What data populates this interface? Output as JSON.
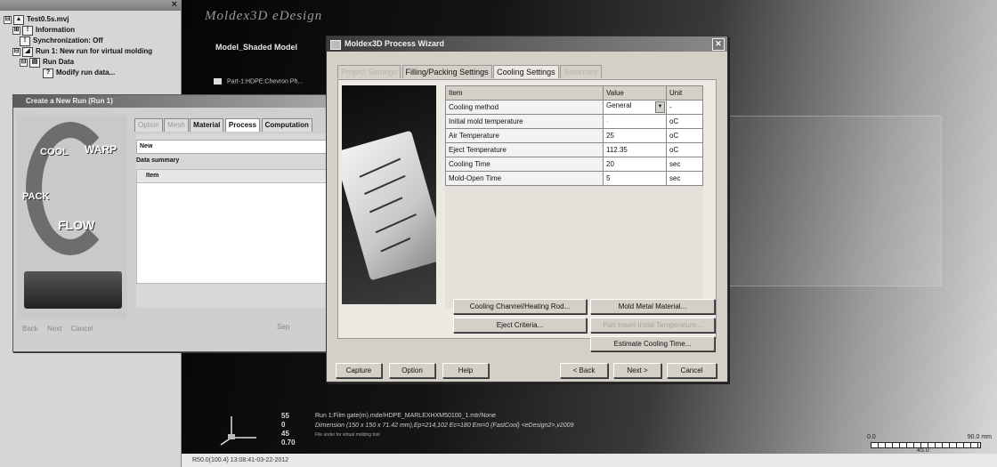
{
  "tree": {
    "items": [
      {
        "pm": "⊟",
        "label": "Test0.5s.mvj",
        "level": 0
      },
      {
        "pm": "⊞",
        "label": "Information",
        "level": 1
      },
      {
        "pm": "",
        "label": "Synchronization: Off",
        "level": 1
      },
      {
        "pm": "⊟",
        "label": "Run 1: New run for virtual molding",
        "level": 1
      },
      {
        "pm": "⊟",
        "label": "Run Data",
        "level": 2
      },
      {
        "pm": "",
        "label": "Modify run data...",
        "level": 3
      }
    ]
  },
  "workspace": {
    "brand": "Moldex3D eDesign",
    "model_title": "Model_Shaded Model",
    "part_line": "Part-1:HDPE:Chevron Ph...",
    "gizmo_values": [
      "55",
      "0",
      "45",
      "0.70"
    ],
    "run_line": "Run 1:Film gate(m).mde/HDPE_MARLEXHXM50100_1.mtr/None",
    "dimension_line": "Dimension (150 x 150 x 71.42 mm),Ep=214,102 Ec=180 Em=0 (FastCool) <eDesign2>,v2009",
    "tiny_line": "File under for virtual molding tool",
    "scale": {
      "left": "0.0",
      "right": "90.0 mm",
      "middle": "45.0"
    }
  },
  "statusbar": {
    "text": "R50.0(100.4) 13:08:41-03-22-2012"
  },
  "new_run_dialog": {
    "title": "Create a New Run (Run 1)",
    "art_words": [
      "COOL",
      "WARP",
      "PACK",
      "FLOW"
    ],
    "tabs": [
      "Option",
      "Mesh",
      "Material",
      "Process",
      "Computation"
    ],
    "name_value": "New",
    "data_summary_label": "Data summary",
    "grid_item_header": "Item",
    "grid_value_header": "V",
    "bottom_buttons": [
      "Back",
      "Next",
      "Cancel"
    ],
    "separate_label": "Sep"
  },
  "wizard": {
    "title": "Moldex3D Process Wizard",
    "close_glyph": "✕",
    "tabs": [
      {
        "label": "Project Settings",
        "state": "dim"
      },
      {
        "label": "Filling/Packing Settings",
        "state": "normal"
      },
      {
        "label": "Cooling Settings",
        "state": "active"
      },
      {
        "label": "Summary",
        "state": "dim"
      }
    ],
    "table": {
      "headers": [
        "Item",
        "Value",
        "Unit"
      ],
      "rows": [
        {
          "item": "Cooling method",
          "value": "General",
          "unit": "-",
          "dropdown": true
        },
        {
          "item": "Initial mold temperature",
          "value": "-",
          "unit": "oC",
          "disabled": true
        },
        {
          "item": "Air Temperature",
          "value": "25",
          "unit": "oC"
        },
        {
          "item": "Eject Temperature",
          "value": "112.35",
          "unit": "oC"
        },
        {
          "item": "Cooling Time",
          "value": "20",
          "unit": "sec"
        },
        {
          "item": "Mold-Open Time",
          "value": "5",
          "unit": "sec"
        }
      ]
    },
    "buttons": {
      "cooling_channel": "Cooling Channel/Heating Rod...",
      "mold_metal": "Mold Metal Material...",
      "eject_criteria": "Eject Criteria...",
      "part_inserts": "Part Insert Initial Temperature...",
      "estimate_cooling": "Estimate Cooling Time...",
      "capture": "Capture",
      "option": "Option",
      "help": "Help",
      "back": "< Back",
      "next": "Next >",
      "cancel": "Cancel"
    }
  }
}
